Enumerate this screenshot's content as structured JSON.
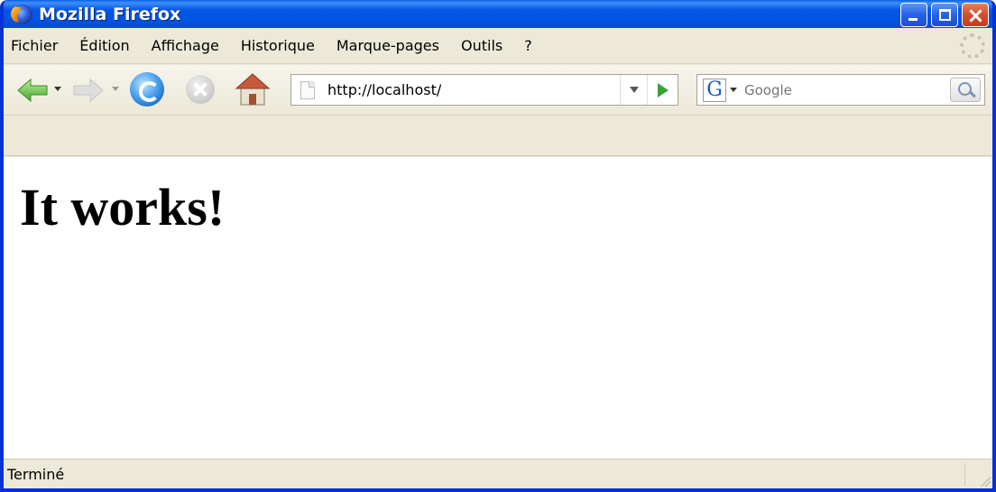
{
  "window": {
    "title": "Mozilla Firefox"
  },
  "menu": {
    "items": [
      "Fichier",
      "Édition",
      "Affichage",
      "Historique",
      "Marque-pages",
      "Outils",
      "?"
    ]
  },
  "navbar": {
    "url": "http://localhost/",
    "search_placeholder": "Google",
    "search_engine_glyph": "G"
  },
  "page": {
    "heading": "It works!"
  },
  "status": {
    "text": "Terminé"
  },
  "colors": {
    "titlebar": "#0054E3",
    "chrome": "#ECE9D8",
    "close_button": "#D34E2A"
  }
}
